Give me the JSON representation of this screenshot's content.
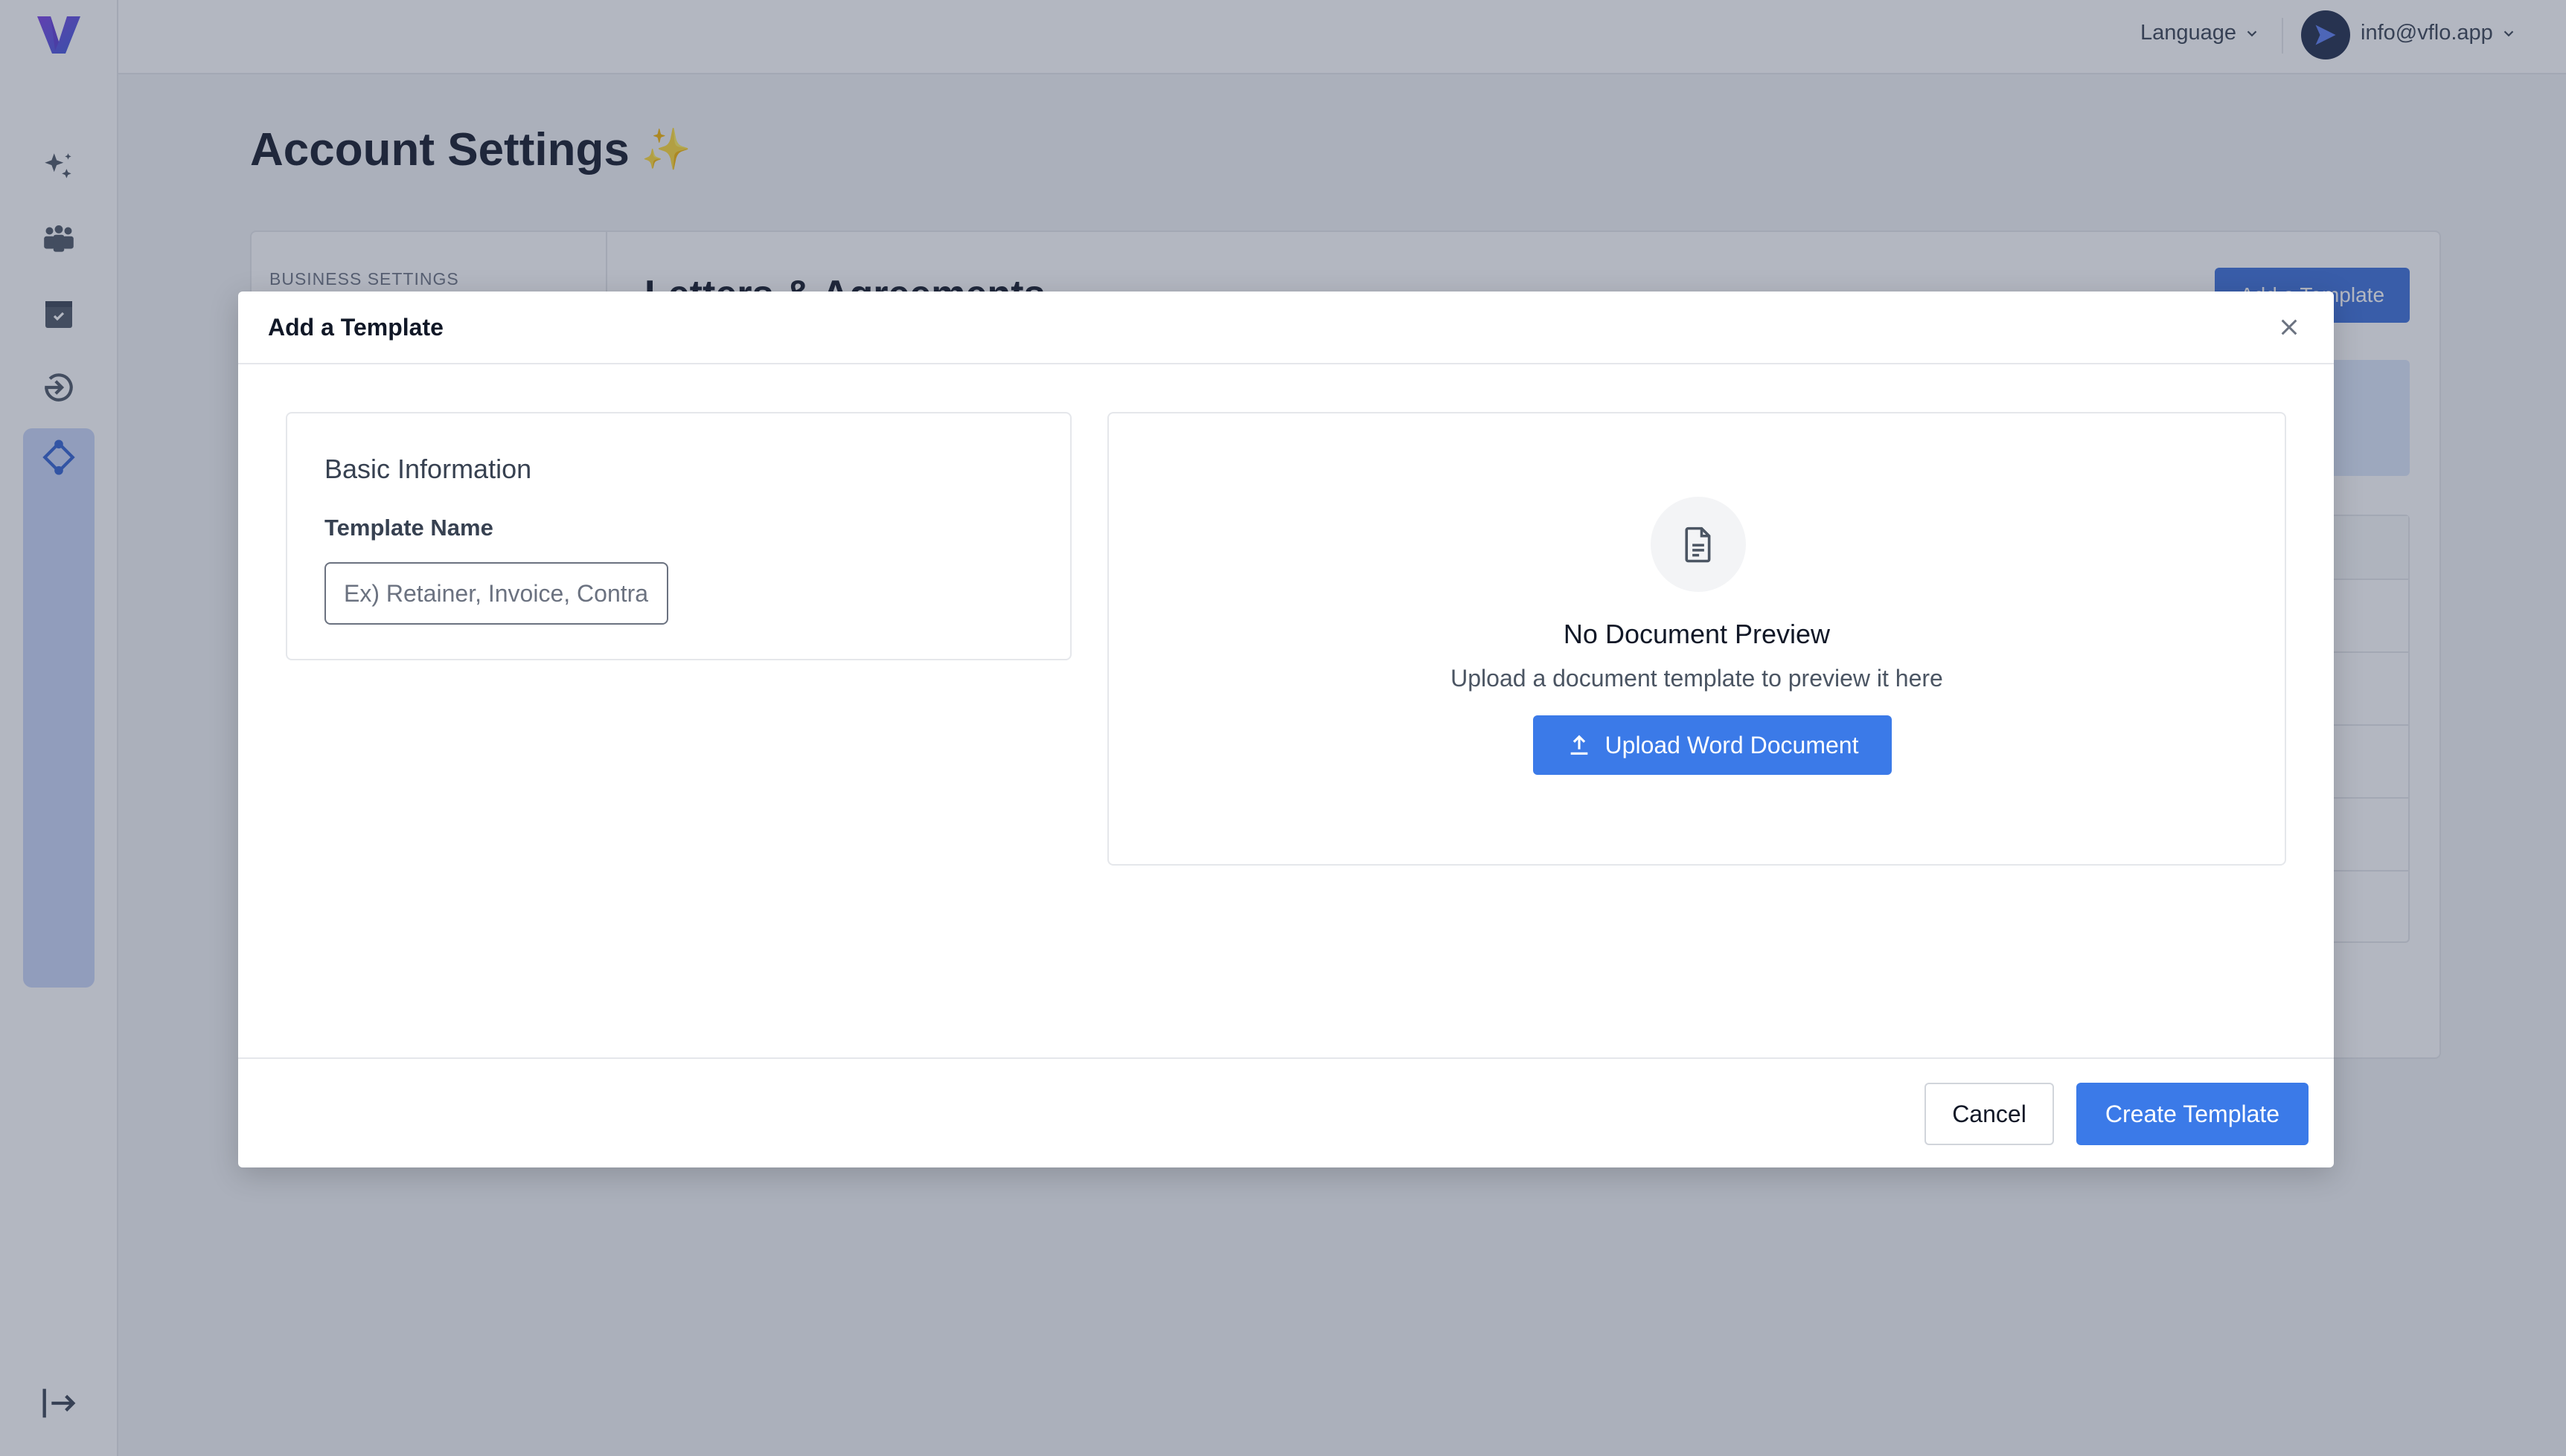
{
  "app": {
    "logo_icon": "vflo-logo-icon"
  },
  "sidebar": {
    "items": [
      {
        "icon": "sparkles-icon"
      },
      {
        "icon": "team-icon"
      },
      {
        "icon": "archive-box-icon"
      },
      {
        "icon": "login-arrow-icon"
      },
      {
        "icon": "workflow-diamond-icon",
        "active": true
      }
    ],
    "collapse_icon": "collapse-sidebar-icon"
  },
  "topbar": {
    "language_label": "Language",
    "user_email": "info@vflo.app"
  },
  "page": {
    "title": "Account Settings",
    "title_emoji": "✨",
    "section_label": "BUSINESS SETTINGS",
    "heading": "Letters & Agreements",
    "add_button": "Add a Template"
  },
  "modal": {
    "title": "Add a Template",
    "basic_info": {
      "title": "Basic Information",
      "template_name_label": "Template Name",
      "template_name_value": "",
      "template_name_placeholder": "Ex) Retainer, Invoice, Contract"
    },
    "preview": {
      "title": "No Document Preview",
      "subtitle": "Upload a document template to preview it here",
      "upload_button": "Upload Word Document"
    },
    "footer": {
      "cancel_label": "Cancel",
      "create_label": "Create Template"
    }
  },
  "colors": {
    "primary": "#3b7ae8",
    "overlay": "#37415b",
    "sidebar_active": "#c9d6f7"
  }
}
